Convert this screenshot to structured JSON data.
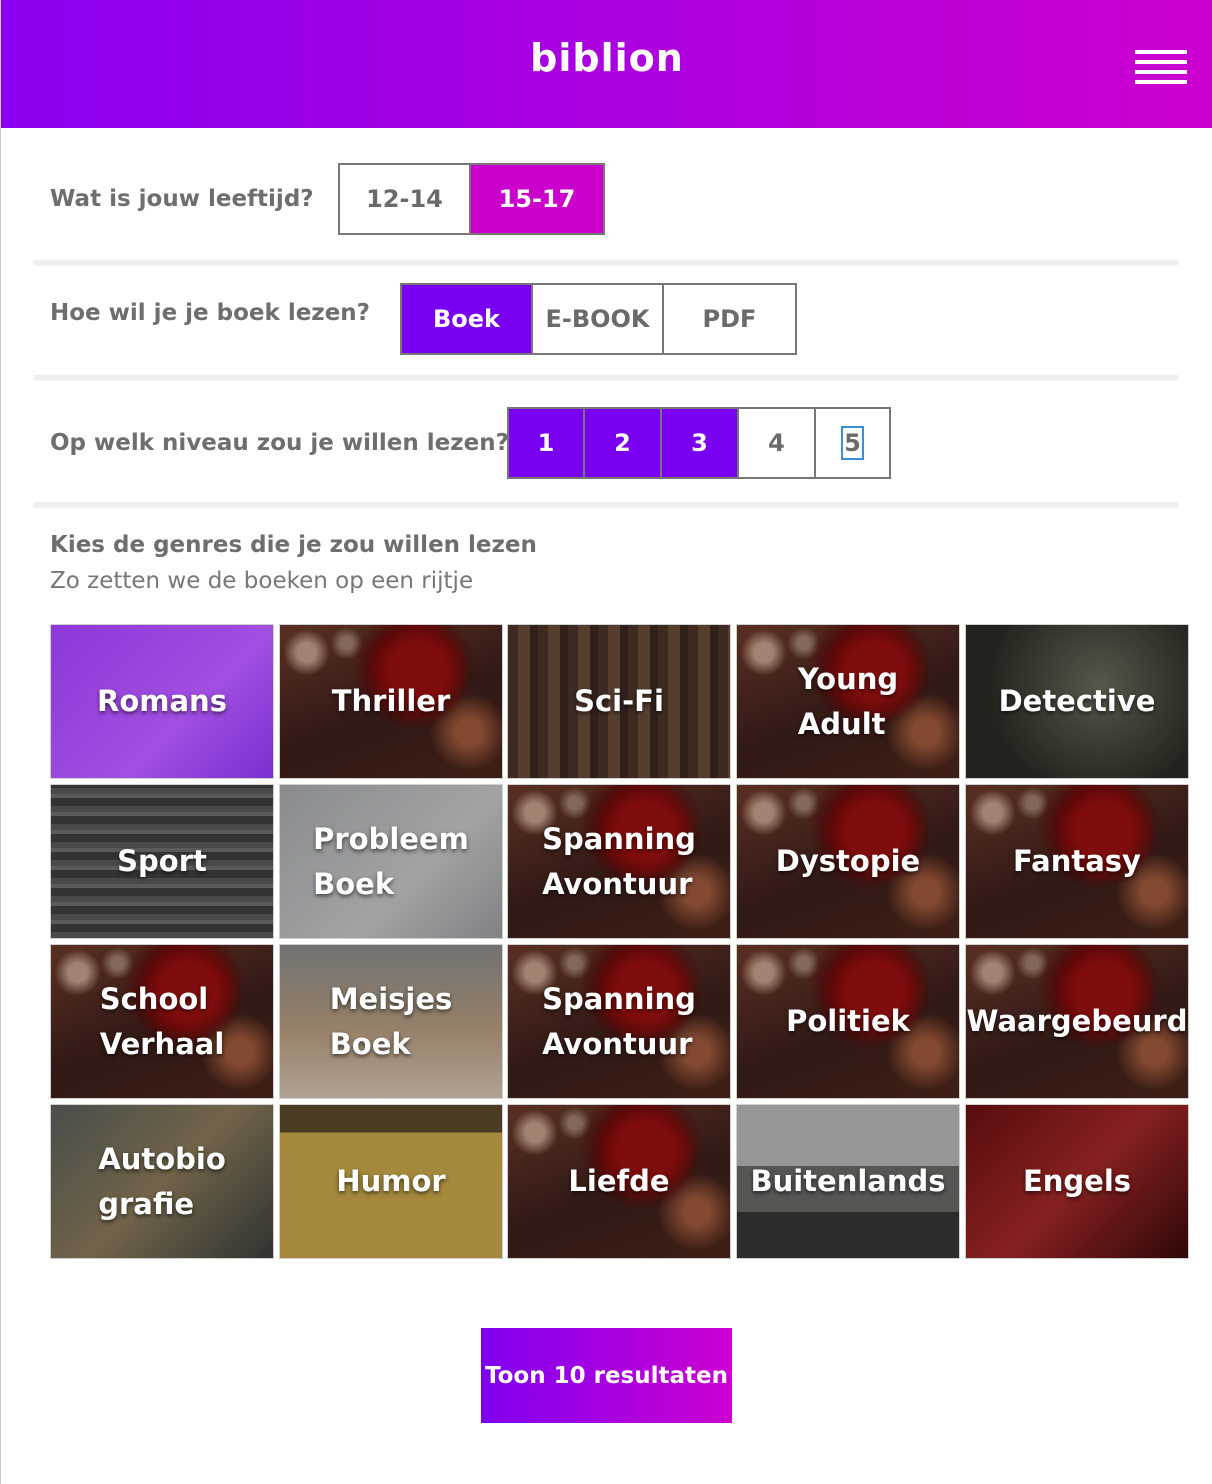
{
  "header": {
    "logo_text": "biblion",
    "menu_icon": "hamburger-menu-icon"
  },
  "age": {
    "question": "Wat is jouw leeftijd?",
    "options": [
      "12-14",
      "15-17"
    ],
    "selected": "15-17"
  },
  "format": {
    "question": "Hoe wil je je boek lezen?",
    "options": [
      "Boek",
      "E-BOOK",
      "PDF"
    ],
    "selected": "Boek"
  },
  "level": {
    "question": "Op welk niveau zou je willen lezen?",
    "options": [
      "1",
      "2",
      "3",
      "4",
      "5"
    ],
    "selected": [
      "1",
      "2",
      "3"
    ]
  },
  "genres": {
    "title": "Kies de genres die je zou willen lezen",
    "subtitle": "Zo zetten we de boeken op een rijtje",
    "items": [
      "Romans",
      "Thriller",
      "Sci-Fi",
      "Young\nAdult",
      "Detective",
      "Sport",
      "Probleem\nBoek",
      "Spanning\nAvontuur",
      "Dystopie",
      "Fantasy",
      "School\nVerhaal",
      "Meisjes\nBoek",
      "Spanning\nAvontuur",
      "Politiek",
      "Waargebeurd",
      "Autobio\ngrafie",
      "Humor",
      "Liefde",
      "Buitenlands",
      "Engels"
    ]
  },
  "cta": {
    "label": "Toon 10 resultaten"
  },
  "colors": {
    "brand_gradient_start": "#8a00f0",
    "brand_gradient_end": "#cc00d0",
    "selected_magenta": "#cc00cc",
    "selected_purple": "#7a00f2"
  }
}
